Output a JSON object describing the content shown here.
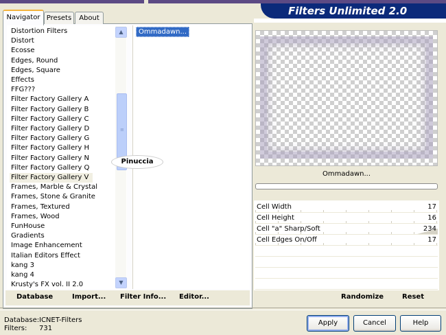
{
  "tabs": [
    "Navigator",
    "Presets",
    "About"
  ],
  "banner_title": "Filters Unlimited 2.0",
  "categories": [
    "Distortion Filters",
    "Distort",
    "Ecosse",
    "Edges, Round",
    "Edges, Square",
    "Effects",
    "FFG???",
    "Filter Factory Gallery A",
    "Filter Factory Gallery B",
    "Filter Factory Gallery C",
    "Filter Factory Gallery D",
    "Filter Factory Gallery G",
    "Filter Factory Gallery H",
    "Filter Factory Gallery N",
    "Filter Factory Gallery Q",
    "Filter Factory Gallery V",
    "Frames, Marble & Crystal",
    "Frames, Stone & Granite",
    "Frames, Textured",
    "Frames, Wood",
    "FunHouse",
    "Gradients",
    "Image Enhancement",
    "Italian Editors Effect",
    "kang 3",
    "kang 4",
    "Krusty's FX vol. II 2.0"
  ],
  "selected_category": "Filter Factory Gallery V",
  "effects": [
    "Ommadawn..."
  ],
  "selected_effect": "Ommadawn...",
  "watermark": "Pinuccia",
  "left_buttons": {
    "database": "Database",
    "import": "Import...",
    "filter_info": "Filter Info...",
    "editor": "Editor..."
  },
  "effect_name": "Ommadawn...",
  "progress": 0,
  "params": [
    {
      "label": "Cell Width",
      "value": "17"
    },
    {
      "label": "Cell Height",
      "value": "16"
    },
    {
      "label": "Cell \"a\" Sharp/Soft",
      "value": "234"
    },
    {
      "label": "Cell Edges On/Off",
      "value": "17"
    }
  ],
  "right_buttons": {
    "randomize": "Randomize",
    "reset": "Reset"
  },
  "status": {
    "database_label": "Database:",
    "database_value": "ICNET-Filters",
    "filters_label": "Filters:",
    "filters_value": "731"
  },
  "dialog": {
    "apply": "Apply",
    "cancel": "Cancel",
    "help": "Help"
  },
  "colors": {
    "banner": "#0b2a7a",
    "selection": "#316ac5",
    "tab_accent": "#f3b33c"
  }
}
